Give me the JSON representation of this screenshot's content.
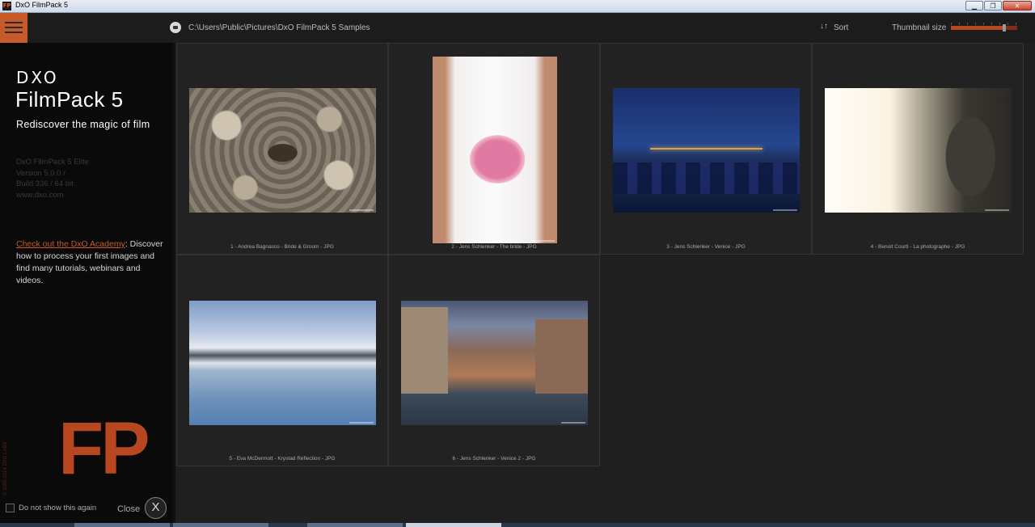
{
  "window": {
    "title": "DxO FilmPack 5",
    "app_icon": "FP",
    "buttons": [
      "minimize",
      "maximize",
      "close"
    ]
  },
  "toolbar": {
    "path": "C:\\Users\\Public\\Pictures\\DxO FilmPack 5 Samples",
    "sort_label": "Sort",
    "sort_icon": "↓↑",
    "thumbnail_label": "Thumbnail size",
    "thumbnail_level": 0.8
  },
  "sidebar": {
    "brand": "DXO",
    "product": "FilmPack 5",
    "tagline": "Rediscover the magic of film",
    "version_lines": [
      "DxO FilmPack 5 Elite",
      "Version 5.0.0 /",
      "Build 336 / 64 bit",
      "www.dxo.com"
    ],
    "academy_link": "Check out the DxO Academy",
    "academy_text": ": Discover how to process your first images and find many tutorials, webinars and videos.",
    "fp_mark": "FP",
    "copyright": "© 2005-2014 DXO LABS",
    "dont_show": "Do not show this again",
    "close_label": "Close",
    "close_icon": "X"
  },
  "thumbnails": [
    {
      "caption": "1 - Andrea Bagnasco - Bride & Groom - JPG"
    },
    {
      "caption": "2 - Jens Schlenker - The bride - JPG"
    },
    {
      "caption": "3 - Jens Schlenker - Venice - JPG"
    },
    {
      "caption": "4 - Benoit Courti - La photographe - JPG"
    },
    {
      "caption": "5 - Eva McDermott - Krystad Reflection - JPG"
    },
    {
      "caption": "6 - Jens Schlenker - Venice 2 - JPG"
    }
  ],
  "colors": {
    "accent": "#c65a28",
    "background": "#1f1f1f",
    "sidebar": "#0a0a0a"
  }
}
